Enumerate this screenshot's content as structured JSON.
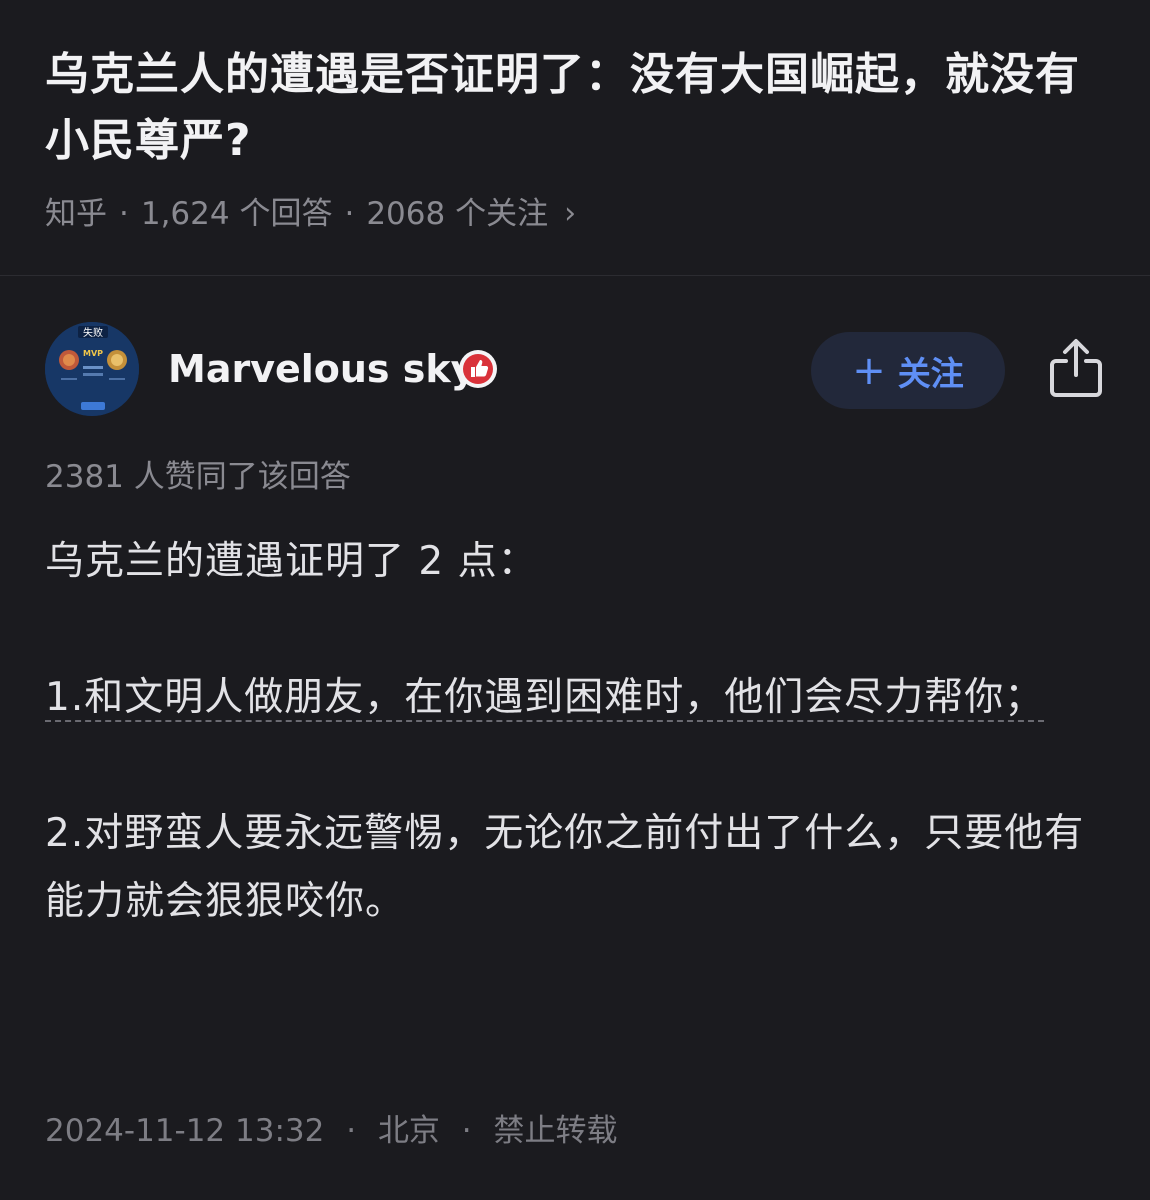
{
  "question": {
    "title": "乌克兰人的遭遇是否证明了：没有大国崛起，就没有小民尊严?",
    "source": "知乎",
    "answers_count": "1,624 个回答",
    "followers_count": "2068 个关注",
    "chevron": "›"
  },
  "author": {
    "name": "Marvelous sky",
    "avatar_text": "失败",
    "avatar_sub": "MVP",
    "badge_icon": "thumbs-up-badge-icon",
    "follow_label": "关注",
    "follow_plus": "+",
    "share_icon": "share-icon",
    "accent_color": "#5f8ff5"
  },
  "answer": {
    "upvote_text": "2381 人赞同了该回答",
    "intro": "乌克兰的遭遇证明了 2 点：",
    "point1_linked": "1.和文明人做朋友，在你遇到困难时，他们会尽力帮你；",
    "point2": "2.对野蛮人要永远警惕，无论你之前付出了什么，只要他有能力就会狠狠咬你。",
    "timestamp": "2024-11-12 13:32",
    "location": "北京",
    "copyright": "禁止转载"
  }
}
